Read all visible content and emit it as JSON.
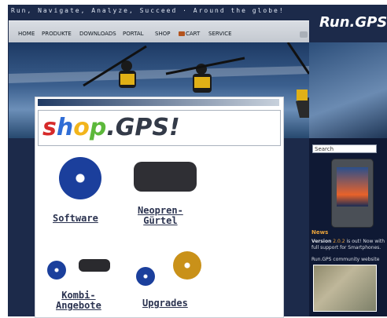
{
  "header": {
    "tagline": "Run, Navigate, Analyze, Succeed · Around the globe!",
    "logo": "Run.GPS!"
  },
  "nav": {
    "items": [
      {
        "label": "HOME"
      },
      {
        "label": "PRODUKTE"
      },
      {
        "label": "DOWNLOADS"
      },
      {
        "label": "PORTAL"
      },
      {
        "label": "SHOP"
      },
      {
        "label": "CART"
      },
      {
        "label": "SERVICE"
      }
    ]
  },
  "sidebar": {
    "search_placeholder": "Search",
    "news_heading": "News",
    "news_text_bold": "Version",
    "news_version": "2.0.2",
    "news_text": "is out! Now with full support for Smartphones.",
    "community_text": "Run.GPS community website"
  },
  "shop": {
    "logo": "shop.GPS!",
    "products": [
      {
        "label": "Software"
      },
      {
        "label": "Neopren-Gürtel"
      },
      {
        "label": "Kombi-Angebote"
      },
      {
        "label": "Upgrades"
      }
    ]
  },
  "colors": {
    "frame": "#1c2a4a",
    "accent": "#e9a23b",
    "link": "#2b3350"
  }
}
